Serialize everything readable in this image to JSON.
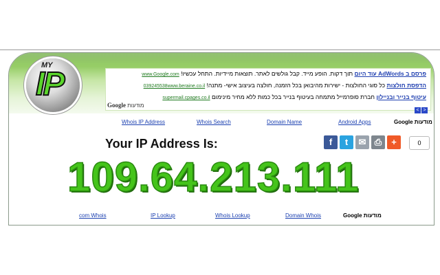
{
  "header": {
    "logo_my": "MY",
    "logo_ip": "IP",
    "ads": [
      {
        "title": "פרסם ב AdWords עוד היום",
        "text": "תוך דקות. הופע מייד. קבל גולשים לאתר. תוצאות מיידיות. התחל עכשיו!",
        "url": "www.Google.com"
      },
      {
        "title": "הדפסת חולצות",
        "text": "כל סוגי החולצות - ישירות מהיבואן בכל הזמנה, חולצה בעיצוב אישי- מתנה!",
        "url": "039245538www.beraine.co.il"
      },
      {
        "title": "עיטוף בנייר ובניילון",
        "text": "חברת סופרמייל מתמחה בעיטוף בנייר בכל כמות ללא מחיר מינימום",
        "url": "supermail.cpages.co.il"
      }
    ],
    "google_label": "Google",
    "ads_label": "מודעות",
    "prev_arrow": "<",
    "next_arrow": ">"
  },
  "links_top": {
    "items": [
      "Whois IP Address",
      "Whois Search",
      "Domain Name",
      "Android Apps"
    ],
    "google_ads": "Google מודעות"
  },
  "main": {
    "heading": "Your IP Address Is:",
    "ip": "109.64.213.111",
    "share_count": "0",
    "social_icons": [
      "facebook-icon",
      "twitter-icon",
      "email-icon",
      "print-icon",
      "plus-icon"
    ],
    "social_glyphs": [
      "f",
      "t",
      "✉",
      "⎙",
      "+"
    ],
    "social_colors": [
      "#3b5998",
      "#2aa3e0",
      "#9aa3ad",
      "#7e868e",
      "#f05a28"
    ]
  },
  "links_bottom": {
    "items": [
      "com Whois",
      "IP Lookup",
      "Whois Lookup",
      "Domain Whois"
    ],
    "google_ads": "Google מודעות"
  }
}
